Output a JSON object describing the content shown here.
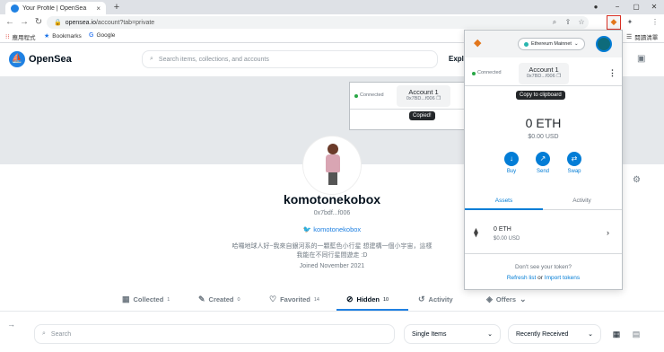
{
  "browser": {
    "tab_title": "Your Profile | OpenSea",
    "tab_close": "×",
    "new_tab": "+",
    "url_domain": "opensea.io",
    "url_path": "/account?tab=private",
    "bookmarks": [
      {
        "label": "應用程式",
        "icon": "apps-grid-icon"
      },
      {
        "label": "Bookmarks",
        "icon": "star-icon"
      },
      {
        "label": "Google",
        "icon": "google-icon"
      }
    ],
    "reading_list": "閱讀清單"
  },
  "opensea": {
    "brand": "OpenSea",
    "search_placeholder": "Search items, collections, and accounts",
    "nav_explore": "Explo",
    "username": "komotonekobox",
    "address": "0x7bdf...f006",
    "twitter": "komotonekobox",
    "bio": "哈囉地球人好~我來自銀河系的一顆藍色小行星 想建構一個小宇宙，這樣我能在不同行星間遊走 :D",
    "joined": "Joined November 2021",
    "tabs": [
      {
        "label": "Collected",
        "count": "1",
        "icon": "grid-icon"
      },
      {
        "label": "Created",
        "count": "0",
        "icon": "brush-icon"
      },
      {
        "label": "Favorited",
        "count": "14",
        "icon": "heart-icon"
      },
      {
        "label": "Hidden",
        "count": "10",
        "icon": "eye-off-icon",
        "active": true
      },
      {
        "label": "Activity",
        "count": "",
        "icon": "history-icon"
      },
      {
        "label": "Offers",
        "count": "",
        "icon": "tag-icon"
      }
    ],
    "filter_search_placeholder": "Search",
    "select_items": "Single Items",
    "select_sort": "Recently Received"
  },
  "page_popup": {
    "connected": "Connected",
    "account_name": "Account 1",
    "account_addr": "0x7BD...f006",
    "tooltip": "Copied!"
  },
  "metamask": {
    "network": "Ethereum Mainnet",
    "connected": "Connected",
    "account_name": "Account 1",
    "account_addr": "0x7BD...f006",
    "tooltip": "Copy to clipboard",
    "balance": "0 ETH",
    "balance_usd": "$0.00 USD",
    "actions": [
      {
        "label": "Buy",
        "icon": "download-icon"
      },
      {
        "label": "Send",
        "icon": "arrow-up-right-icon"
      },
      {
        "label": "Swap",
        "icon": "swap-icon"
      }
    ],
    "tab_assets": "Assets",
    "tab_activity": "Activity",
    "asset_amount": "0 ETH",
    "asset_usd": "$0.00 USD",
    "dont_see": "Don't see your token?",
    "refresh": "Refresh list",
    "or": "or",
    "import": "Import tokens"
  },
  "colors": {
    "opensea_blue": "#2081e2",
    "metamask_blue": "#037dd6",
    "highlight_red": "#d93025"
  }
}
